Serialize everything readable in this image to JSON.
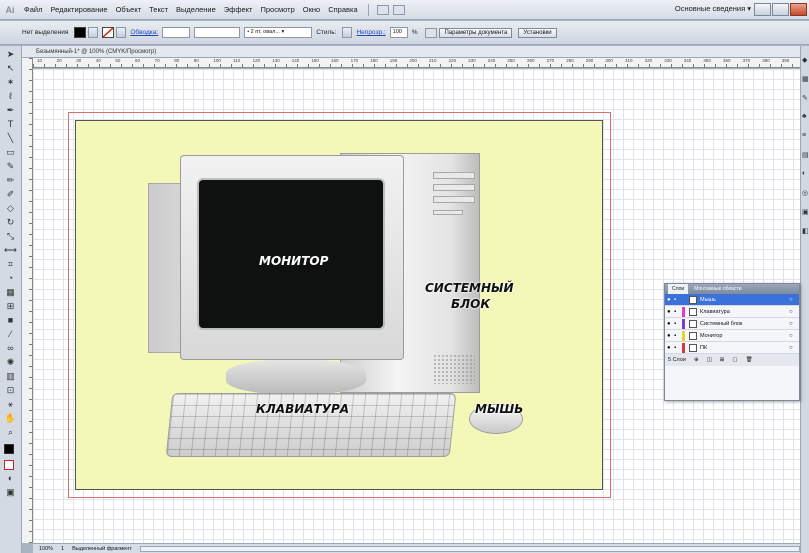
{
  "menubar": {
    "logo": "Ai",
    "items": [
      "Файл",
      "Редактирование",
      "Объект",
      "Текст",
      "Выделение",
      "Эффект",
      "Просмотр",
      "Окно",
      "Справка"
    ],
    "workspace": "Основные сведения ▾"
  },
  "controlbar": {
    "selection_label": "Нет выделения",
    "stroke_label": "Обводка:",
    "opacity_text": "• 2 пт. овал... ▾",
    "style_label": "Стиль:",
    "opacity_link": "Непрозр.:",
    "opacity_value": "100",
    "percent": "%",
    "doc_settings_button": "Параметры документа",
    "preferences_button": "Установки"
  },
  "document": {
    "tab_title": "Безымянный-1* @ 100% (CMYK/Просмотр)",
    "ruler_numbers": [
      "10",
      "20",
      "30",
      "40",
      "50",
      "60",
      "70",
      "80",
      "90",
      "100",
      "110",
      "120",
      "130",
      "140",
      "150",
      "160",
      "170",
      "180",
      "190",
      "200",
      "210",
      "220",
      "230",
      "240",
      "250",
      "260",
      "270",
      "280",
      "290",
      "300",
      "310",
      "320",
      "330",
      "340",
      "350",
      "360",
      "370",
      "380",
      "390"
    ]
  },
  "artwork": {
    "monitor_label": "МОНИТОР",
    "system_unit_label_line1": "СИСТЕМНЫЙ",
    "system_unit_label_line2": "БЛОК",
    "keyboard_label": "КЛАВИАТУРА",
    "mouse_label": "МЫШЬ",
    "artboard_color": "#f3f7b7",
    "bleed_color": "#d86f6f"
  },
  "layers_panel": {
    "tabs": [
      "Слои",
      "Монтажные области"
    ],
    "layers": [
      {
        "name": "Мышь",
        "color": "#3b72d9",
        "selected": true
      },
      {
        "name": "Клавиатура",
        "color": "#e03cd0",
        "selected": false
      },
      {
        "name": "Системный блок",
        "color": "#7a3cd0",
        "selected": false
      },
      {
        "name": "Монитор",
        "color": "#e6d329",
        "selected": false
      },
      {
        "name": "ПК",
        "color": "#d03c3c",
        "selected": false
      }
    ],
    "footer_count": "5 Слои"
  },
  "statusbar": {
    "zoom": "100%",
    "page": "1",
    "status_text": "Выделенный фрагмент"
  }
}
